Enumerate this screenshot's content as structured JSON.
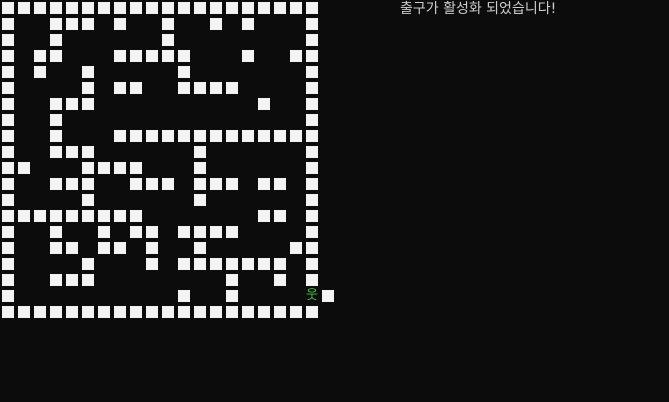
{
  "status_message": "출구가 활성화 되었습니다!",
  "colors": {
    "background": "#0c0c0c",
    "wall": "#f2f2f2",
    "player": "#3ec73e",
    "text": "#cccccc"
  },
  "player": {
    "glyph": "웃",
    "row": 18,
    "col": 18,
    "icon": "player-stick-figure-icon"
  },
  "exit": {
    "row": 18,
    "col": 19
  },
  "maze": [
    "####################",
    "#  ### #  #  # #   #",
    "#  #      #        #",
    "# ##   #####   #  ##",
    "# #  #     #       #",
    "#    # ##  ####    #",
    "#  ###          #  #",
    "#  #               #",
    "#  #   #############",
    "#  ###      #      #",
    "##   ####   #      #",
    "#  ###  ### ### ## #",
    "#    #      #      #",
    "#########       ## #",
    "#  #  # ## ####    #",
    "#  ## ## #  #     ##",
    "#    #   # ####### #",
    "#  ###        #  # #",
    "#          #  #    @#",
    "####################"
  ]
}
